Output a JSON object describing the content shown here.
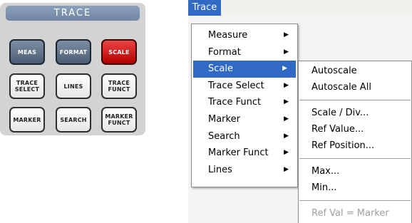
{
  "panel": {
    "title": "TRACE",
    "keys": {
      "meas": "MEAS",
      "format": "FORMAT",
      "scale": "SCALE",
      "trace_select": "TRACE\nSELECT",
      "lines": "LINES",
      "trace_funct": "TRACE\nFUNCT",
      "marker": "MARKER",
      "search": "SEARCH",
      "marker_funct": "MARKER\nFUNCT"
    }
  },
  "menubar": {
    "trace": "Trace"
  },
  "trace_menu": {
    "items": [
      {
        "label": "Measure"
      },
      {
        "label": "Format"
      },
      {
        "label": "Scale"
      },
      {
        "label": "Trace Select"
      },
      {
        "label": "Trace Funct"
      },
      {
        "label": "Marker"
      },
      {
        "label": "Search"
      },
      {
        "label": "Marker Funct"
      },
      {
        "label": "Lines"
      }
    ],
    "selected": "Scale"
  },
  "scale_submenu": {
    "autoscale": "Autoscale",
    "autoscale_all": "Autoscale All",
    "scale_div": "Scale / Div...",
    "ref_value": "Ref Value...",
    "ref_position": "Ref Position...",
    "max": "Max...",
    "min": "Min...",
    "ref_val_marker": "Ref Val = Marker"
  },
  "icons": {
    "submenu_arrow": "triangle-right-icon"
  },
  "colors": {
    "highlight": "#316ac5",
    "scale_key": "#cc0000",
    "panel_title": "#7a90ab"
  }
}
